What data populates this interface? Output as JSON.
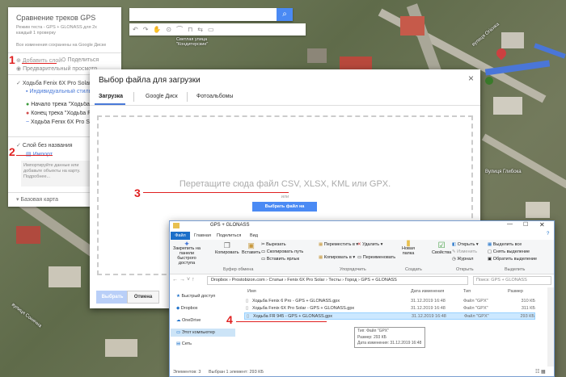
{
  "left_panel": {
    "title": "Сравнение треков GPS",
    "description": "Режим теста - GPS + GLONASS для 2х каждый 1 проверку",
    "saved_note": "Все изменения сохранены на Google Диске",
    "add_layer": "Добавить слой",
    "share": "Поделиться",
    "preview": "Предварительный просмотр",
    "layer1_name": "Ходьба Fenix 6X Pro Solar - GPS + GLONASS",
    "layer1_style": "Индивидуальный стиль",
    "item_start": "Начало трека \"Ходьба Fenix 6X Pro...\"",
    "item_end": "Конец трека \"Ходьба Fenix 6X...\"",
    "item_track": "Ходьба Fenix 6X Pro Solar...",
    "layer2_name": "Слой без названия",
    "import": "Импорт",
    "import_hint": "Импортируйте данные или добавьте объекты на карту. Подробнее...",
    "base_map": "Базовая карта"
  },
  "map": {
    "poi": "Светлая улица \"Кондитерские\"",
    "street1": "вулиця Огієнка",
    "street2": "Вулиця Глибока",
    "street3": "вулиця Сонячна"
  },
  "dialog": {
    "title": "Выбор файла для загрузки",
    "tabs": [
      "Загрузка",
      "Google Диск",
      "Фотоальбомы"
    ],
    "drop_text": "Перетащите сюда файл CSV, XLSX, KML или GPX.",
    "or": "или",
    "choose_button": "Выбрать файл на устройстве",
    "select_button": "Выбрать",
    "cancel_button": "Отмена",
    "close": "×"
  },
  "explorer": {
    "title": "GPS + GLONASS",
    "ribbon_tabs": [
      "Файл",
      "Главная",
      "Поделиться",
      "Вид"
    ],
    "help": "?",
    "ribbon_buttons": {
      "pin": "Закрепить на панели быстрого доступа",
      "copy": "Копировать",
      "paste": "Вставить",
      "cut": "Вырезать",
      "copy_path": "Скопировать путь",
      "paste_shortcut": "Вставить ярлык",
      "move_to": "Переместить в",
      "copy_to": "Копировать в",
      "delete": "Удалить",
      "rename": "Переименовать",
      "new_folder": "Новая папка",
      "properties": "Свойства",
      "open": "Открыть",
      "edit": "Изменить",
      "history": "Журнал",
      "select_all": "Выделить все",
      "select_none": "Снять выделение",
      "invert": "Обратить выделение"
    },
    "groups": [
      "Буфер обмена",
      "Упорядочить",
      "Создать",
      "Открыть",
      "Выделить"
    ],
    "breadcrumb": [
      "Dropbox",
      "Prostobizon.com",
      "Статьи",
      "Fenix 6X Pro Solar",
      "Тесты",
      "Город",
      "GPS + GLONASS"
    ],
    "search_placeholder": "Поиск: GPS + GLONASS",
    "nav": [
      "Быстрый доступ",
      "Dropbox",
      "OneDrive",
      "Этот компьютер",
      "Сеть"
    ],
    "columns": [
      "Имя",
      "Дата изменения",
      "Тип",
      "Размер"
    ],
    "files": [
      {
        "name": "Ходьба Fenix 6 Pro - GPS + GLONASS.gpx",
        "date": "31.12.2019 16:48",
        "type": "Файл \"GPX\"",
        "size": "310 КБ"
      },
      {
        "name": "Ходьба Fenix 6X Pro Solar - GPS + GLONASS.gpx",
        "date": "31.12.2019 16:48",
        "type": "Файл \"GPX\"",
        "size": "311 КБ"
      },
      {
        "name": "Ходьба FR 945 - GPS + GLONASS.gpx",
        "date": "31.12.2019 16:48",
        "type": "Файл \"GPX\"",
        "size": "293 КБ"
      }
    ],
    "tooltip": [
      "Тип: Файл \"GPX\"",
      "Размер: 293 КБ",
      "Дата изменения: 31.12.2019 16:48"
    ],
    "status": {
      "count": "Элементов: 3",
      "selected": "Выбран 1 элемент: 293 КБ"
    }
  },
  "annotations": [
    "1",
    "2",
    "3",
    "4"
  ]
}
